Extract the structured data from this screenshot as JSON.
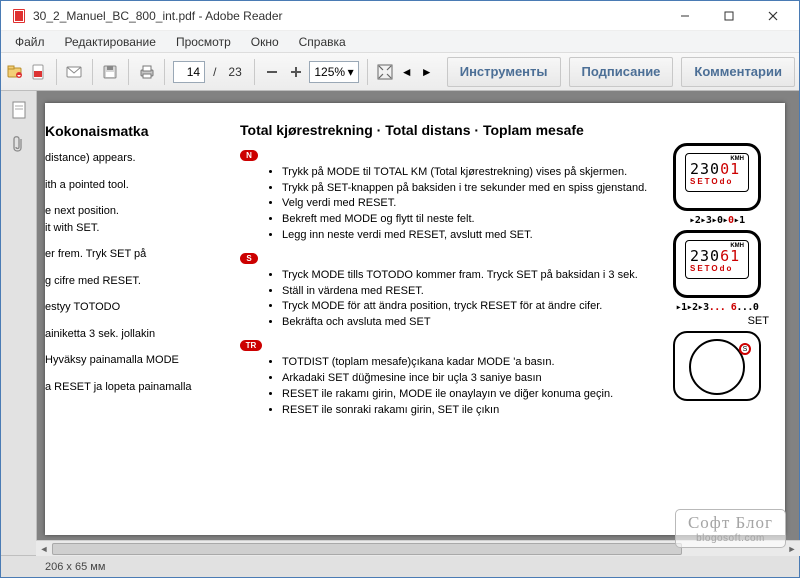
{
  "window": {
    "title": "30_2_Manuel_BC_800_int.pdf - Adobe Reader"
  },
  "menu": {
    "file": "Файл",
    "edit": "Редактирование",
    "view": "Просмотр",
    "window": "Окно",
    "help": "Справка"
  },
  "toolbar": {
    "page_current": "14",
    "page_sep": "/",
    "page_total": "23",
    "zoom": "125%",
    "tools": "Инструменты",
    "sign": "Подписание",
    "comments": "Комментарии"
  },
  "doc": {
    "left": {
      "h": "Kokonaismatka",
      "p1": "distance) appears.",
      "p2": "ith a pointed tool.",
      "p3": "e next position.\nit with SET.",
      "p4": "er frem. Tryk SET på",
      "p5": "g cifre med RESET.",
      "p6": "estyy TOTODO",
      "p7": "ainiketta 3 sek. jollakin",
      "p8": "Hyväksy painamalla MODE",
      "p9": "a RESET ja lopeta painamalla"
    },
    "mid": {
      "h": "Total kjørestrekning · Total distans · Toplam mesafe",
      "n": {
        "badge": "N",
        "l1": "Trykk på MODE til TOTAL KM (Total kjørestrekning) vises på skjermen.",
        "l2": "Trykk på SET-knappen på baksiden i tre sekunder med en spiss gjenstand.",
        "l3": "Velg verdi med RESET.",
        "l4": "Bekreft med MODE og flytt til neste felt.",
        "l5": "Legg inn neste verdi med RESET, avslutt med SET."
      },
      "s": {
        "badge": "S",
        "l1": "Tryck MODE tills TOTODO kommer fram. Tryck SET på baksidan i 3 sek.",
        "l2": "Ställ in värdena med RESET.",
        "l3": "Tryck MODE för att ändra position, tryck RESET för at ändre cifer.",
        "l4": "Bekräfta och avsluta med SET"
      },
      "tr": {
        "badge": "TR",
        "l1": "TOTDIST (toplam mesafe)çıkana kadar MODE 'a basın.",
        "l2": "Arkadaki SET düğmesine ince bir uçla 3 saniye basın",
        "l3": "RESET ile rakamı girin, MODE ile onaylayın ve diğer konuma geçin.",
        "l4": "RESET ile sonraki rakamı girin, SET ile çıkın"
      }
    },
    "right": {
      "kmh": "KMH",
      "d1_big_a": "230",
      "d1_big_b": "01",
      "d1_lbl": "SETOdo",
      "arrow1_a": "▸2▸3▸0▸",
      "arrow1_b": "0",
      "arrow1_c": "▸1",
      "d2_big_a": "230",
      "d2_big_b": "61",
      "d2_lbl": "SETOdo",
      "arrow2_a": "▸1▸2▸3",
      "arrow2_b": "... 6",
      "arrow2_c": "...0",
      "set": "SET",
      "sbtn": "S"
    }
  },
  "status": {
    "dim": "206 x 65 мм"
  },
  "watermark": {
    "l1": "Софт Блог",
    "l2": "blogosoft.com"
  }
}
